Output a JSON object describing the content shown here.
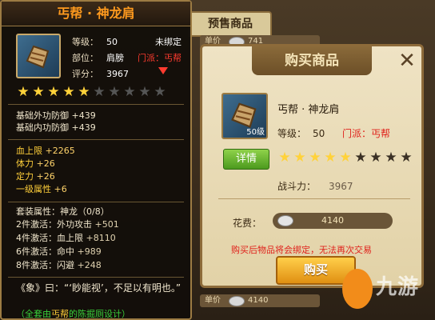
{
  "background": {
    "tab_label": "预售商品",
    "strip_top": "单价",
    "strip_top_value": "741",
    "strip_bottom": "单价",
    "strip_bottom_value": "4140"
  },
  "tooltip": {
    "title": "丐帮 · 神龙肩",
    "level_label": "等级：",
    "level_value": "50",
    "bind_status": "未绑定",
    "part_label": "部位：",
    "part_value": "肩膀",
    "sect_text": "门派：丐帮",
    "score_label": "评分：",
    "score_value": "3967",
    "stars_filled": 5,
    "stars_total": 10,
    "base_attrs": [
      {
        "label": "基础外功防御",
        "value": "+439"
      },
      {
        "label": "基础内功防御",
        "value": "+439"
      }
    ],
    "bonus_attrs": [
      {
        "label": "血上限",
        "value": "+2265"
      },
      {
        "label": "体力",
        "value": "+26"
      },
      {
        "label": "定力",
        "value": "+26"
      },
      {
        "label": "一级属性",
        "value": "+6"
      }
    ],
    "set_header": "套装属性：神龙（0/8）",
    "set_attrs": [
      {
        "label": "2件激活：外功攻击",
        "value": "+501"
      },
      {
        "label": "4件激活：血上限",
        "value": "+8110"
      },
      {
        "label": "6件激活：命中",
        "value": "+989"
      },
      {
        "label": "8件激活：闪避",
        "value": "+248"
      }
    ],
    "quote": "《象》曰：“‘眇能视’，不足以有明也。”",
    "footer_prefix": "（全套由",
    "footer_org": "丐帮",
    "footer_suffix": "的陈掘厕设计）"
  },
  "dialog": {
    "title": "购买商品",
    "item_name": "丐帮 · 神龙肩",
    "item_level_badge": "50级",
    "level_label": "等级：",
    "level_value": "50",
    "sect_text": "门派：丐帮",
    "detail_button": "详情",
    "stars_filled": 5,
    "stars_total": 9,
    "power_label": "战斗力：",
    "power_value": "3967",
    "cost_label": "花费：",
    "cost_value": "4140",
    "warning": "购买后物品将会绑定，无法再次交易",
    "buy_button": "购买"
  },
  "watermark": {
    "text": "九游"
  },
  "colors": {
    "accent_orange": "#ff9a1e",
    "sect_red": "#e0211b",
    "star_gold": "#ffd23a",
    "footer_green": "#39d03a"
  }
}
